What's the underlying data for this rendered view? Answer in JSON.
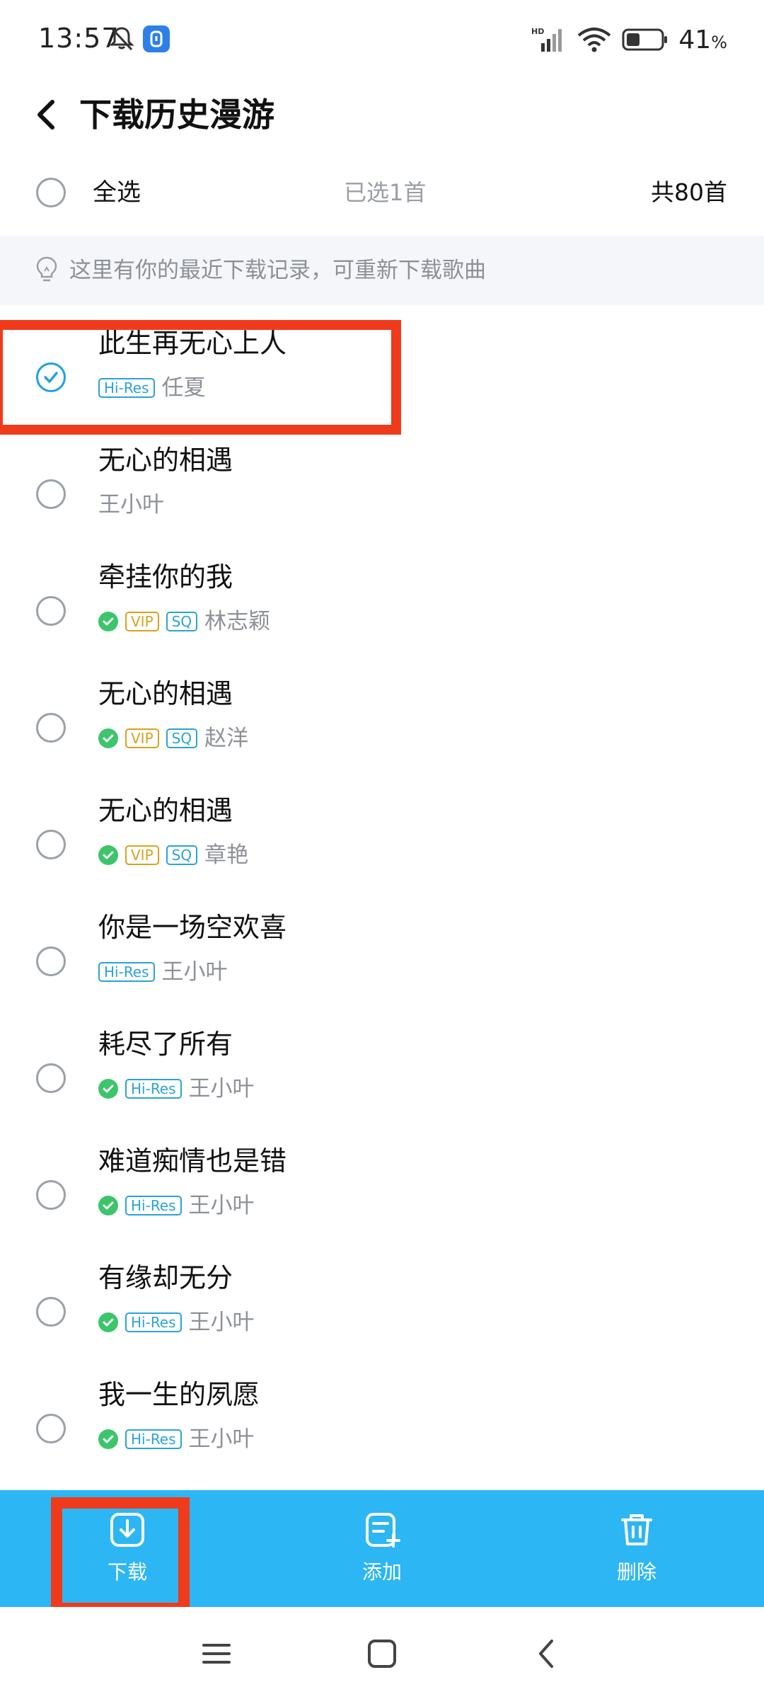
{
  "status_bar": {
    "time": "13:57",
    "battery_percent": "41",
    "battery_unit": "%",
    "network": "HD",
    "battery_level": 0.41
  },
  "header": {
    "title": "下载历史漫游"
  },
  "select_bar": {
    "select_all_label": "全选",
    "selected_count": "已选1首",
    "total_count": "共80首"
  },
  "tip": {
    "text": "这里有你的最近下载记录，可重新下载歌曲"
  },
  "songs": [
    {
      "title": "此生再无心上人",
      "artist": "任夏",
      "checked": true,
      "downloaded": false,
      "tags": [
        "Hi-Res"
      ]
    },
    {
      "title": "无心的相遇",
      "artist": "王小叶",
      "checked": false,
      "downloaded": false,
      "tags": []
    },
    {
      "title": "牵挂你的我",
      "artist": "林志颖",
      "checked": false,
      "downloaded": true,
      "tags": [
        "VIP",
        "SQ"
      ]
    },
    {
      "title": "无心的相遇",
      "artist": "赵洋",
      "checked": false,
      "downloaded": true,
      "tags": [
        "VIP",
        "SQ"
      ]
    },
    {
      "title": "无心的相遇",
      "artist": "章艳",
      "checked": false,
      "downloaded": true,
      "tags": [
        "VIP",
        "SQ"
      ]
    },
    {
      "title": "你是一场空欢喜",
      "artist": "王小叶",
      "checked": false,
      "downloaded": false,
      "tags": [
        "Hi-Res"
      ]
    },
    {
      "title": "耗尽了所有",
      "artist": "王小叶",
      "checked": false,
      "downloaded": true,
      "tags": [
        "Hi-Res"
      ]
    },
    {
      "title": "难道痴情也是错",
      "artist": "王小叶",
      "checked": false,
      "downloaded": true,
      "tags": [
        "Hi-Res"
      ]
    },
    {
      "title": "有缘却无分",
      "artist": "王小叶",
      "checked": false,
      "downloaded": true,
      "tags": [
        "Hi-Res"
      ]
    },
    {
      "title": "我一生的夙愿",
      "artist": "王小叶",
      "checked": false,
      "downloaded": true,
      "tags": [
        "Hi-Res"
      ]
    }
  ],
  "actions": {
    "download_label": "下载",
    "add_label": "添加",
    "delete_label": "删除"
  },
  "colors": {
    "accent": "#2cb6f4",
    "highlight": "#f03a1c",
    "downloaded": "#3cc56b",
    "vip": "#d7a31c",
    "hires": "#2aa3d6"
  }
}
